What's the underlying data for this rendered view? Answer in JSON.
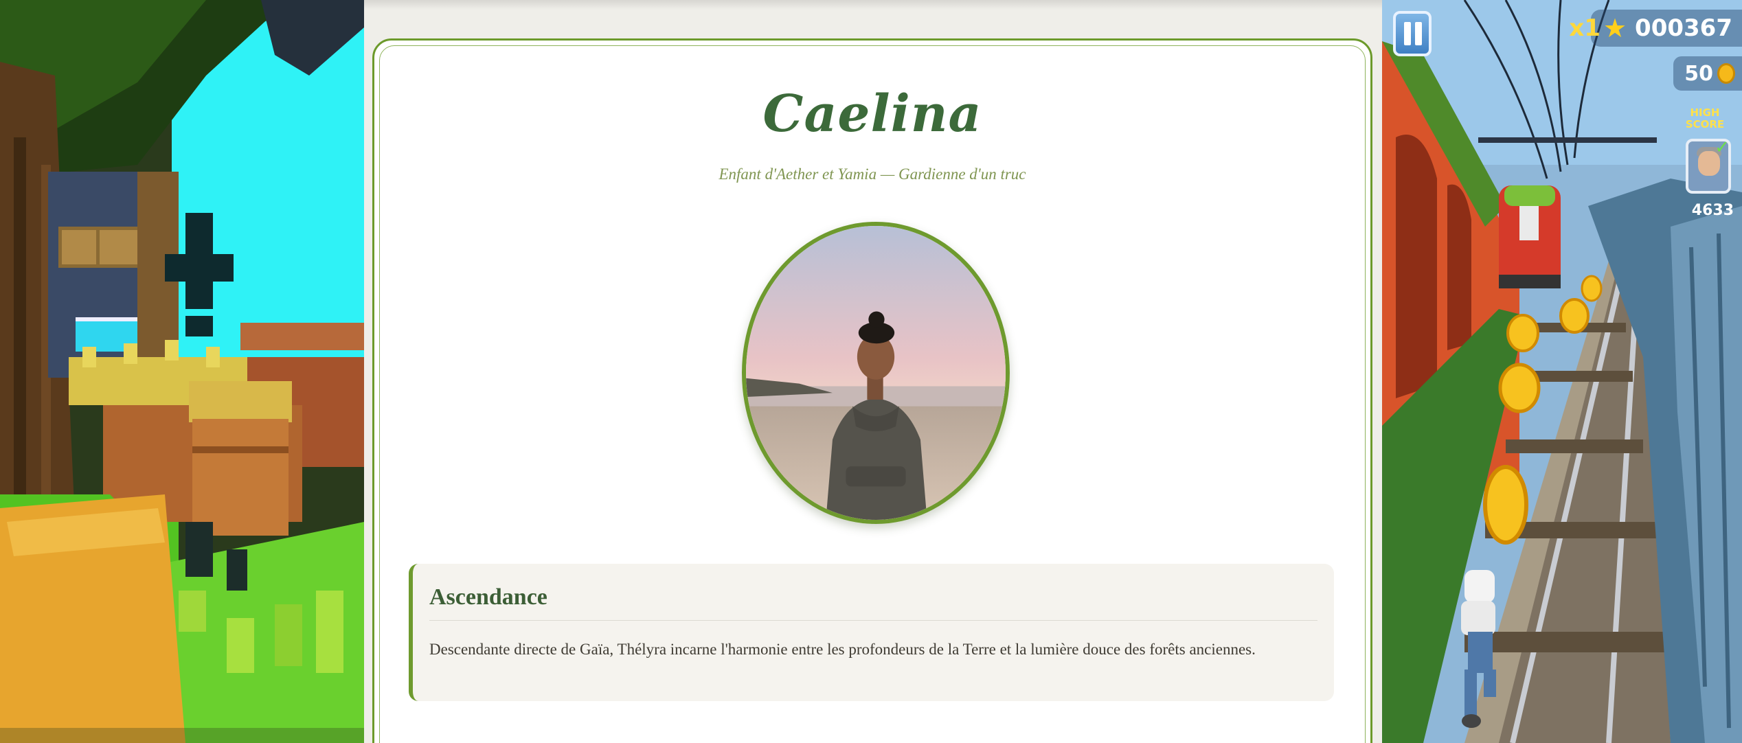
{
  "profile": {
    "name": "Caelina",
    "subtitle": "Enfant d'Aether et Yamia — Gardienne d'un truc",
    "section": {
      "title": "Ascendance",
      "text": "Descendante directe de Gaïa, Thélyra incarne l'harmonie entre les profondeurs de la Terre et la lumière douce des forêts anciennes."
    }
  },
  "game_hud": {
    "multiplier": "x1",
    "score": "000367",
    "coins": "50",
    "high_score_label": "HIGH SCORE",
    "high_score": "4633"
  },
  "colors": {
    "accent_green": "#6e9a2e",
    "name_green": "#3c6a3a",
    "subtitle_olive": "#7f9551",
    "section_bg": "#f5f3ee"
  }
}
